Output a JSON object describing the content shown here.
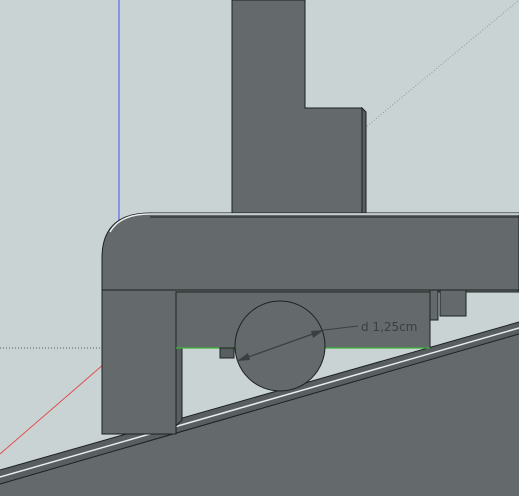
{
  "viewport": {
    "background": "#c9d3d3"
  },
  "model": {
    "solid_color": "#646a6b",
    "solid_shadow_color": "#595f60",
    "edge_color": "#1c2020",
    "highlight_color": "#e7eded"
  },
  "axes": {
    "blue_axis_color": "#4d4dff",
    "red_axis_color": "#e05050",
    "green_axis_color": "#3bb33b",
    "inference_color": "#8d9aa0"
  },
  "dimension": {
    "label": "d 1,25cm",
    "color": "#3a3f40"
  }
}
